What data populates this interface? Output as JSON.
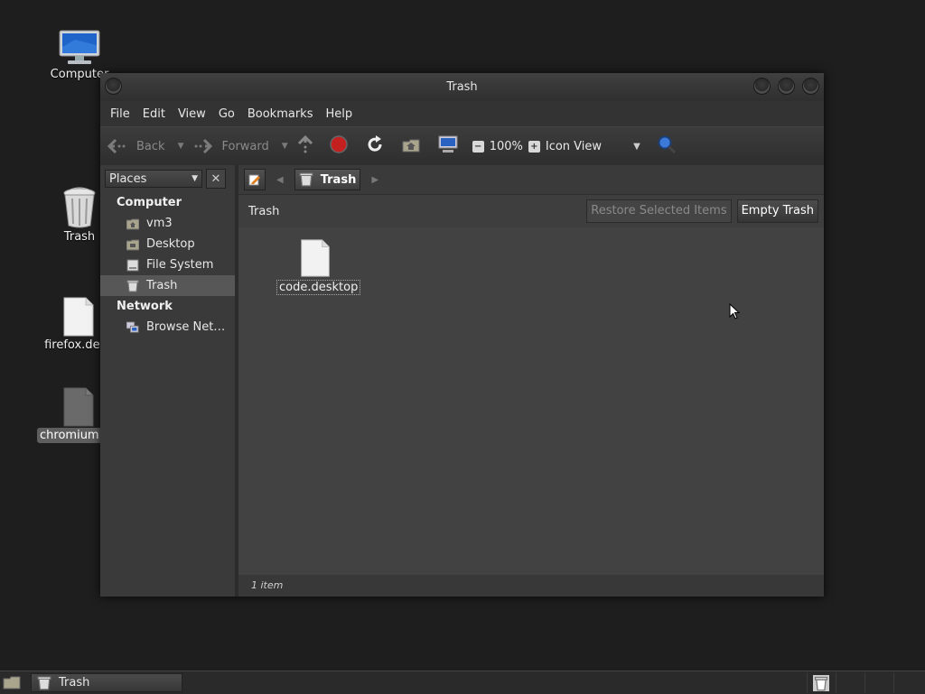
{
  "desktop": {
    "icons": [
      {
        "label": "Computer",
        "selected": false
      },
      {
        "label": "Trash",
        "selected": false
      },
      {
        "label": "firefox.desk",
        "selected": false
      },
      {
        "label": "chromium.de",
        "selected": true
      }
    ]
  },
  "window": {
    "title": "Trash",
    "menu": [
      "File",
      "Edit",
      "View",
      "Go",
      "Bookmarks",
      "Help"
    ],
    "toolbar": {
      "back_label": "Back",
      "forward_label": "Forward",
      "zoom": "100%",
      "view_mode": "Icon View"
    },
    "sidebar": {
      "selector_label": "Places",
      "sections": [
        {
          "title": "Computer",
          "items": [
            {
              "label": "vm3",
              "icon": "home-folder-icon"
            },
            {
              "label": "Desktop",
              "icon": "desktop-folder-icon"
            },
            {
              "label": "File System",
              "icon": "drive-icon"
            },
            {
              "label": "Trash",
              "icon": "trash-icon",
              "selected": true
            }
          ]
        },
        {
          "title": "Network",
          "items": [
            {
              "label": "Browse Net…",
              "icon": "network-icon"
            }
          ]
        }
      ]
    },
    "pathbar": {
      "crumb": "Trash"
    },
    "infobar": {
      "title": "Trash",
      "restore_label": "Restore Selected Items",
      "empty_label": "Empty Trash"
    },
    "files": [
      {
        "name": "code.desktop"
      }
    ],
    "status": "1 item"
  },
  "taskbar": {
    "task_label": "Trash"
  }
}
